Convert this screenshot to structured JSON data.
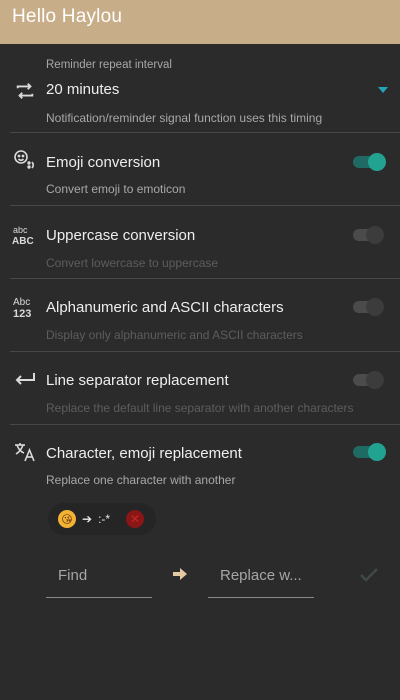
{
  "header": {
    "title": "Hello Haylou"
  },
  "repeat_interval": {
    "caption": "Reminder repeat interval",
    "value": "20 minutes",
    "description": "Notification/reminder signal function uses this timing"
  },
  "settings": [
    {
      "label": "Emoji conversion",
      "description": "Convert emoji to emoticon",
      "enabled": true
    },
    {
      "label": "Uppercase conversion",
      "description": "Convert lowercase to uppercase",
      "enabled": false
    },
    {
      "label": "Alphanumeric and ASCII characters",
      "description": "Display only alphanumeric and ASCII characters",
      "enabled": false
    },
    {
      "label": "Line separator replacement",
      "description": "Replace the default line separator with another characters",
      "enabled": false
    },
    {
      "label": "Character, emoji replacement",
      "description": "Replace one character with another",
      "enabled": true
    }
  ],
  "replacement_chip": {
    "from_emoji": "😘",
    "arrow": "➔",
    "to": ":-*"
  },
  "replace_form": {
    "find_placeholder": "Find",
    "replace_placeholder": "Replace w..."
  },
  "colors": {
    "header_bg": "#c8ad89",
    "accent": "#22a392",
    "dropdown_accent": "#21a6b9",
    "background": "#2b2b2b"
  }
}
